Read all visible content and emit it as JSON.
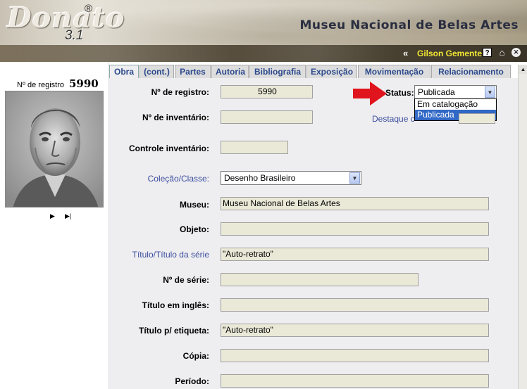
{
  "header": {
    "logo": "Donato",
    "logo_reg": "®",
    "logo_version": "3.1",
    "museum_title": "Museu Nacional de Belas Artes"
  },
  "userbar": {
    "collapse": "«",
    "user_name": "Gilson Gemente",
    "help_icon": "?",
    "home_icon": "⌂",
    "close_icon": "✕"
  },
  "left_panel": {
    "reg_label": "Nº de registro",
    "reg_number": "5990",
    "nav_next": "▶",
    "nav_last": "▶|"
  },
  "tabs": [
    {
      "label": "Obra",
      "active": true
    },
    {
      "label": "(cont.)"
    },
    {
      "label": "Partes"
    },
    {
      "label": "Autoria"
    },
    {
      "label": "Bibliografia"
    },
    {
      "label": "Exposição"
    },
    {
      "label": "Movimentação"
    },
    {
      "label": "Relacionamento"
    }
  ],
  "form": {
    "registro": {
      "label": "Nº de registro:",
      "value": "5990"
    },
    "inventario": {
      "label": "Nº de inventário:",
      "value": ""
    },
    "controle": {
      "label": "Controle inventário:",
      "value": ""
    },
    "colecao": {
      "label": "Coleção/Classe:",
      "value": "Desenho Brasileiro"
    },
    "museu": {
      "label": "Museu:",
      "value": "Museu Nacional de Belas Artes"
    },
    "objeto": {
      "label": "Objeto:",
      "value": ""
    },
    "titulo": {
      "label": "Título/Título da série",
      "value": "\"Auto-retrato\""
    },
    "serie": {
      "label": "Nº de série:",
      "value": ""
    },
    "titulo_ingles": {
      "label": "Título em inglês:",
      "value": ""
    },
    "titulo_etiqueta": {
      "label": "Título p/ etiqueta:",
      "value": "\"Auto-retrato\""
    },
    "copia": {
      "label": "Cópia:",
      "value": ""
    },
    "periodo": {
      "label": "Período:",
      "value": ""
    },
    "status": {
      "label": "Status:",
      "value": "Publicada",
      "options": [
        "Em catalogação",
        "Publicada"
      ]
    },
    "destaque_label": "Destaque c"
  },
  "colors": {
    "accent": "#3a4ea0",
    "tab_text": "#2c4a8c",
    "input_bg": "#eae9d8",
    "form_bg": "#eeedef",
    "username": "#f2e833",
    "selection": "#3168c6",
    "arrow": "#e0141c"
  }
}
